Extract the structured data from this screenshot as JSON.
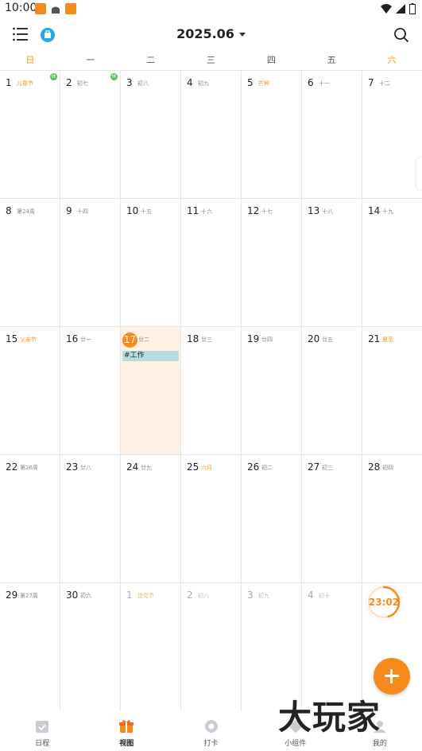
{
  "status_bar": {
    "time": "10:00"
  },
  "header": {
    "title": "2025.06"
  },
  "weekdays": [
    "日",
    "一",
    "二",
    "三",
    "四",
    "五",
    "六"
  ],
  "weeks": [
    [
      {
        "num": "1",
        "sub": "儿童节",
        "festival": true,
        "badge": "休"
      },
      {
        "num": "2",
        "sub": "初七",
        "badge": "休"
      },
      {
        "num": "3",
        "sub": "初八"
      },
      {
        "num": "4",
        "sub": "初九"
      },
      {
        "num": "5",
        "sub": "芒种",
        "festival": true
      },
      {
        "num": "6",
        "sub": "十一"
      },
      {
        "num": "7",
        "sub": "十二"
      }
    ],
    [
      {
        "num": "8",
        "sub": "第24周"
      },
      {
        "num": "9",
        "sub": "十四"
      },
      {
        "num": "10",
        "sub": "十五"
      },
      {
        "num": "11",
        "sub": "十六"
      },
      {
        "num": "12",
        "sub": "十七"
      },
      {
        "num": "13",
        "sub": "十八"
      },
      {
        "num": "14",
        "sub": "十九"
      }
    ],
    [
      {
        "num": "15",
        "sub": "父亲节",
        "festival": true
      },
      {
        "num": "16",
        "sub": "廿一"
      },
      {
        "num": "17",
        "sub": "廿二",
        "today": true,
        "event": "#工作"
      },
      {
        "num": "18",
        "sub": "廿三"
      },
      {
        "num": "19",
        "sub": "廿四"
      },
      {
        "num": "20",
        "sub": "廿五"
      },
      {
        "num": "21",
        "sub": "夏至",
        "festival": true
      }
    ],
    [
      {
        "num": "22",
        "sub": "第26周"
      },
      {
        "num": "23",
        "sub": "廿八"
      },
      {
        "num": "24",
        "sub": "廿九"
      },
      {
        "num": "25",
        "sub": "六月",
        "festival": true
      },
      {
        "num": "26",
        "sub": "初二"
      },
      {
        "num": "27",
        "sub": "初三"
      },
      {
        "num": "28",
        "sub": "初四"
      }
    ],
    [
      {
        "num": "29",
        "sub": "第27周"
      },
      {
        "num": "30",
        "sub": "初六"
      },
      {
        "num": "1",
        "sub": "建党节",
        "festival": true,
        "other": true
      },
      {
        "num": "2",
        "sub": "初八",
        "other": true
      },
      {
        "num": "3",
        "sub": "初九",
        "other": true
      },
      {
        "num": "4",
        "sub": "初十",
        "other": true
      },
      {
        "num": "",
        "sub": "",
        "other": true
      }
    ]
  ],
  "timer": {
    "text": "23:02",
    "progress": 0.45
  },
  "bottom_nav": [
    {
      "label": "日程",
      "icon": "calendar-check-icon"
    },
    {
      "label": "视图",
      "icon": "gift-view-icon",
      "active": true
    },
    {
      "label": "打卡",
      "icon": "checkin-icon"
    },
    {
      "label": "小组件",
      "icon": "widget-icon"
    },
    {
      "label": "我的",
      "icon": "profile-icon"
    }
  ],
  "watermark": "大玩家",
  "colors": {
    "accent": "#f58a1d",
    "weekend": "#f39a1e",
    "today_bg": "#fef1e4",
    "event_chip": "#b7dde0",
    "rest_badge": "#5ab85a",
    "share": "#28a8e0"
  }
}
